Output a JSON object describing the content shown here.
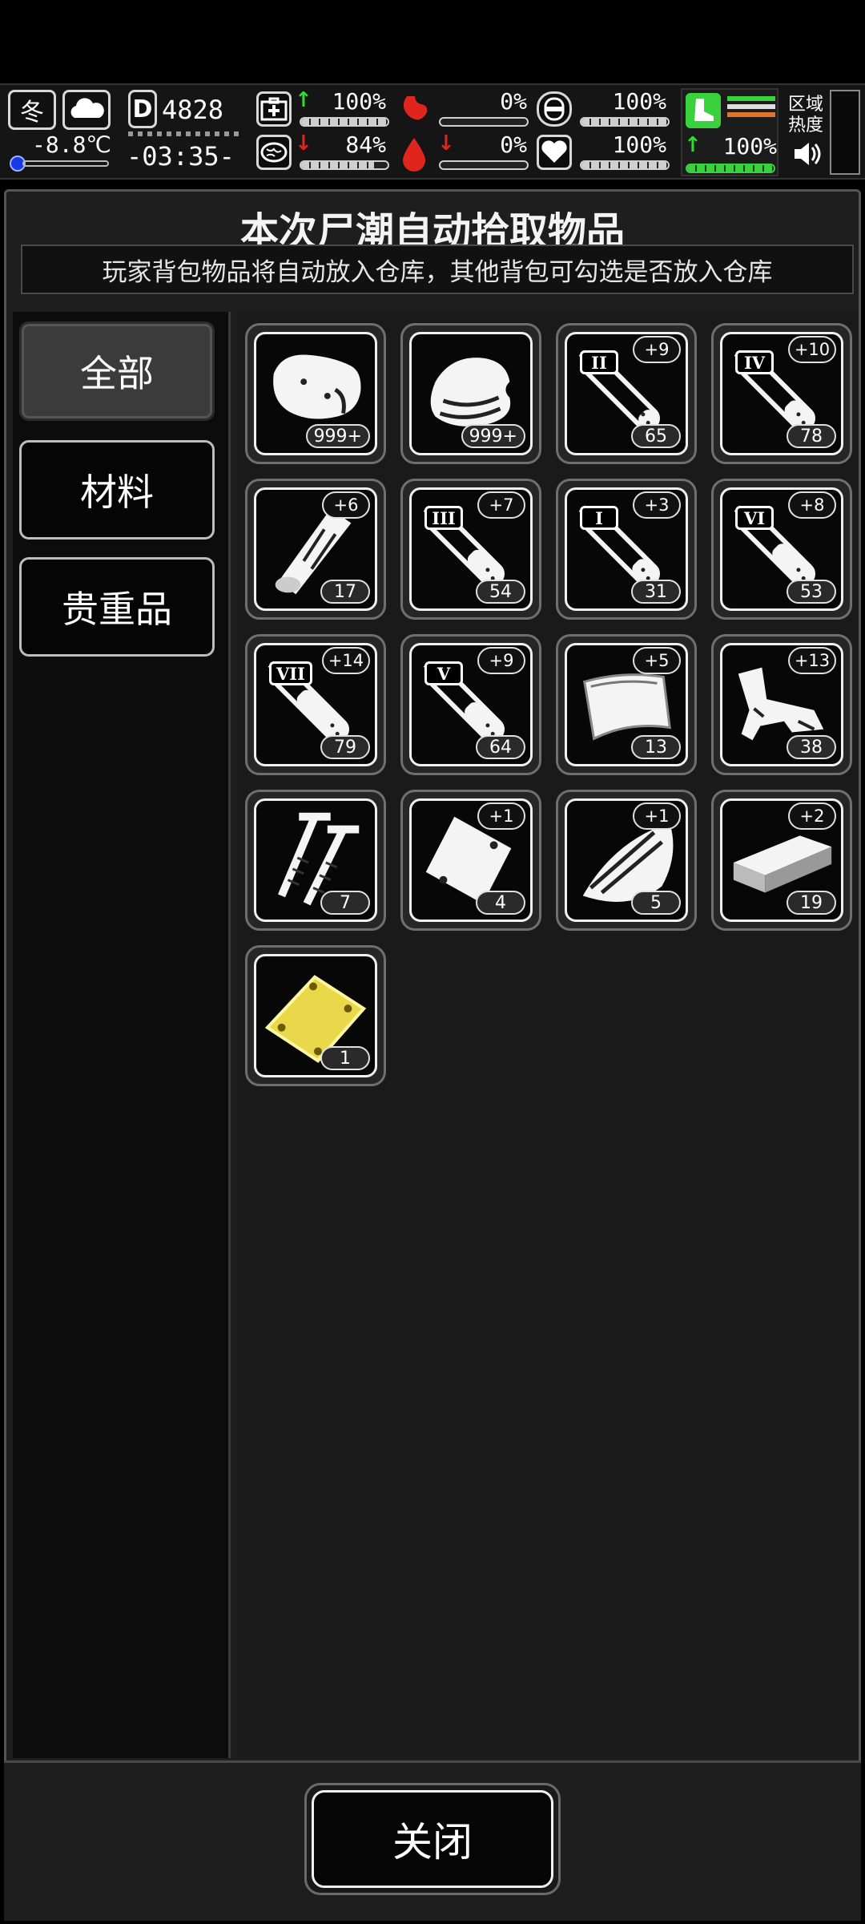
{
  "hud": {
    "season": "冬",
    "temperature": "-8.8℃",
    "day": "4828",
    "time": "-03:35-",
    "stats": [
      {
        "name": "health",
        "value": "100%",
        "trend": "up",
        "fill": 1.0
      },
      {
        "name": "stomach",
        "value": "0%",
        "trend": "",
        "fill": 0.0
      },
      {
        "name": "thirst",
        "value": "100%",
        "trend": "",
        "fill": 1.0
      },
      {
        "name": "mood",
        "value": "84%",
        "trend": "down",
        "fill": 0.84
      },
      {
        "name": "blood",
        "value": "0%",
        "trend": "down",
        "fill": 0.0
      },
      {
        "name": "heart",
        "value": "100%",
        "trend": "",
        "fill": 1.0
      },
      {
        "name": "stamina",
        "value": "100%",
        "trend": "up",
        "fill": 1.0
      }
    ],
    "zone_label": "区域热度"
  },
  "panel": {
    "title": "本次尸潮自动拾取物品",
    "subtitle": "玩家背包物品将自动放入仓库，其他背包可勾选是否放入仓库"
  },
  "tabs": [
    {
      "label": "全部",
      "active": true
    },
    {
      "label": "材料",
      "active": false
    },
    {
      "label": "贵重品",
      "active": false
    }
  ],
  "items": [
    {
      "icon": "meat-icon",
      "count": "999+",
      "bonus": "",
      "roman": ""
    },
    {
      "icon": "cloth-icon",
      "count": "999+",
      "bonus": "",
      "roman": ""
    },
    {
      "icon": "syringe-icon",
      "count": "65",
      "bonus": "+9",
      "roman": "II",
      "fill": 0.2
    },
    {
      "icon": "syringe-icon",
      "count": "78",
      "bonus": "+10",
      "roman": "IV",
      "fill": 0.35
    },
    {
      "icon": "wood-plank-icon",
      "count": "17",
      "bonus": "+6",
      "roman": ""
    },
    {
      "icon": "syringe-icon",
      "count": "54",
      "bonus": "+7",
      "roman": "III",
      "fill": 0.45
    },
    {
      "icon": "syringe-icon",
      "count": "31",
      "bonus": "+3",
      "roman": "I",
      "fill": 0.3
    },
    {
      "icon": "syringe-icon",
      "count": "53",
      "bonus": "+8",
      "roman": "VI",
      "fill": 0.55
    },
    {
      "icon": "syringe-icon",
      "count": "79",
      "bonus": "+14",
      "roman": "VII",
      "fill": 0.7
    },
    {
      "icon": "syringe-icon",
      "count": "64",
      "bonus": "+9",
      "roman": "V",
      "fill": 0.5
    },
    {
      "icon": "metal-sheet-icon",
      "count": "13",
      "bonus": "+5",
      "roman": ""
    },
    {
      "icon": "scrap-metal-icon",
      "count": "38",
      "bonus": "+13",
      "roman": ""
    },
    {
      "icon": "screws-icon",
      "count": "7",
      "bonus": "",
      "roman": ""
    },
    {
      "icon": "plastic-bag-icon",
      "count": "4",
      "bonus": "+1",
      "roman": ""
    },
    {
      "icon": "broken-wood-icon",
      "count": "5",
      "bonus": "+1",
      "roman": ""
    },
    {
      "icon": "brick-icon",
      "count": "19",
      "bonus": "+2",
      "roman": ""
    },
    {
      "icon": "gold-plate-icon",
      "count": "1",
      "bonus": "",
      "roman": ""
    }
  ],
  "footer": {
    "close_label": "关闭"
  },
  "colors": {
    "accent_green": "#39d13c",
    "alert_red": "#e0241e",
    "gold": "#e8d84a"
  }
}
